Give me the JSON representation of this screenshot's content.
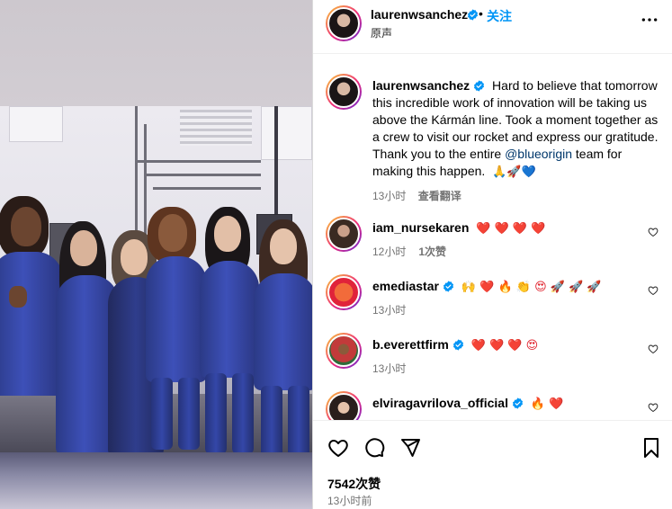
{
  "header": {
    "username": "laurenwsanchez",
    "follow_label": "关注",
    "audio_label": "原声",
    "separator": "•"
  },
  "caption": {
    "username": "laurenwsanchez",
    "text_before": "Hard to believe that tomorrow this incredible work of innovation will be taking us above the Kármán line. Took a moment together as a crew to visit our rocket and express our gratitude. Thank you to the entire ",
    "mention": "@blueorigin",
    "text_after": " team for making this happen. ",
    "emojis": "🙏🚀💙",
    "time": "13小时",
    "translate_label": "查看翻译"
  },
  "comments": [
    {
      "username": "iam_nursekaren",
      "verified": false,
      "text": "❤️ ❤️ ❤️ ❤️",
      "time": "12小时",
      "likes": "1次赞"
    },
    {
      "username": "emediastar",
      "verified": true,
      "text": "🙌 ❤️ 🔥 👏 😍 🚀 🚀 🚀",
      "time": "13小时",
      "likes": ""
    },
    {
      "username": "b.everettfirm",
      "verified": true,
      "text": "❤️ ❤️ ❤️ 😍",
      "time": "13小时",
      "likes": ""
    },
    {
      "username": "elviragavrilova_official",
      "verified": true,
      "text": "🔥 ❤️",
      "time": "",
      "likes": ""
    }
  ],
  "footer": {
    "likes": "7542次赞",
    "time": "13小时前"
  },
  "colors": {
    "accent": "#0095f6",
    "verified": "#0095f6",
    "mention": "#00376b",
    "muted": "#737373"
  }
}
